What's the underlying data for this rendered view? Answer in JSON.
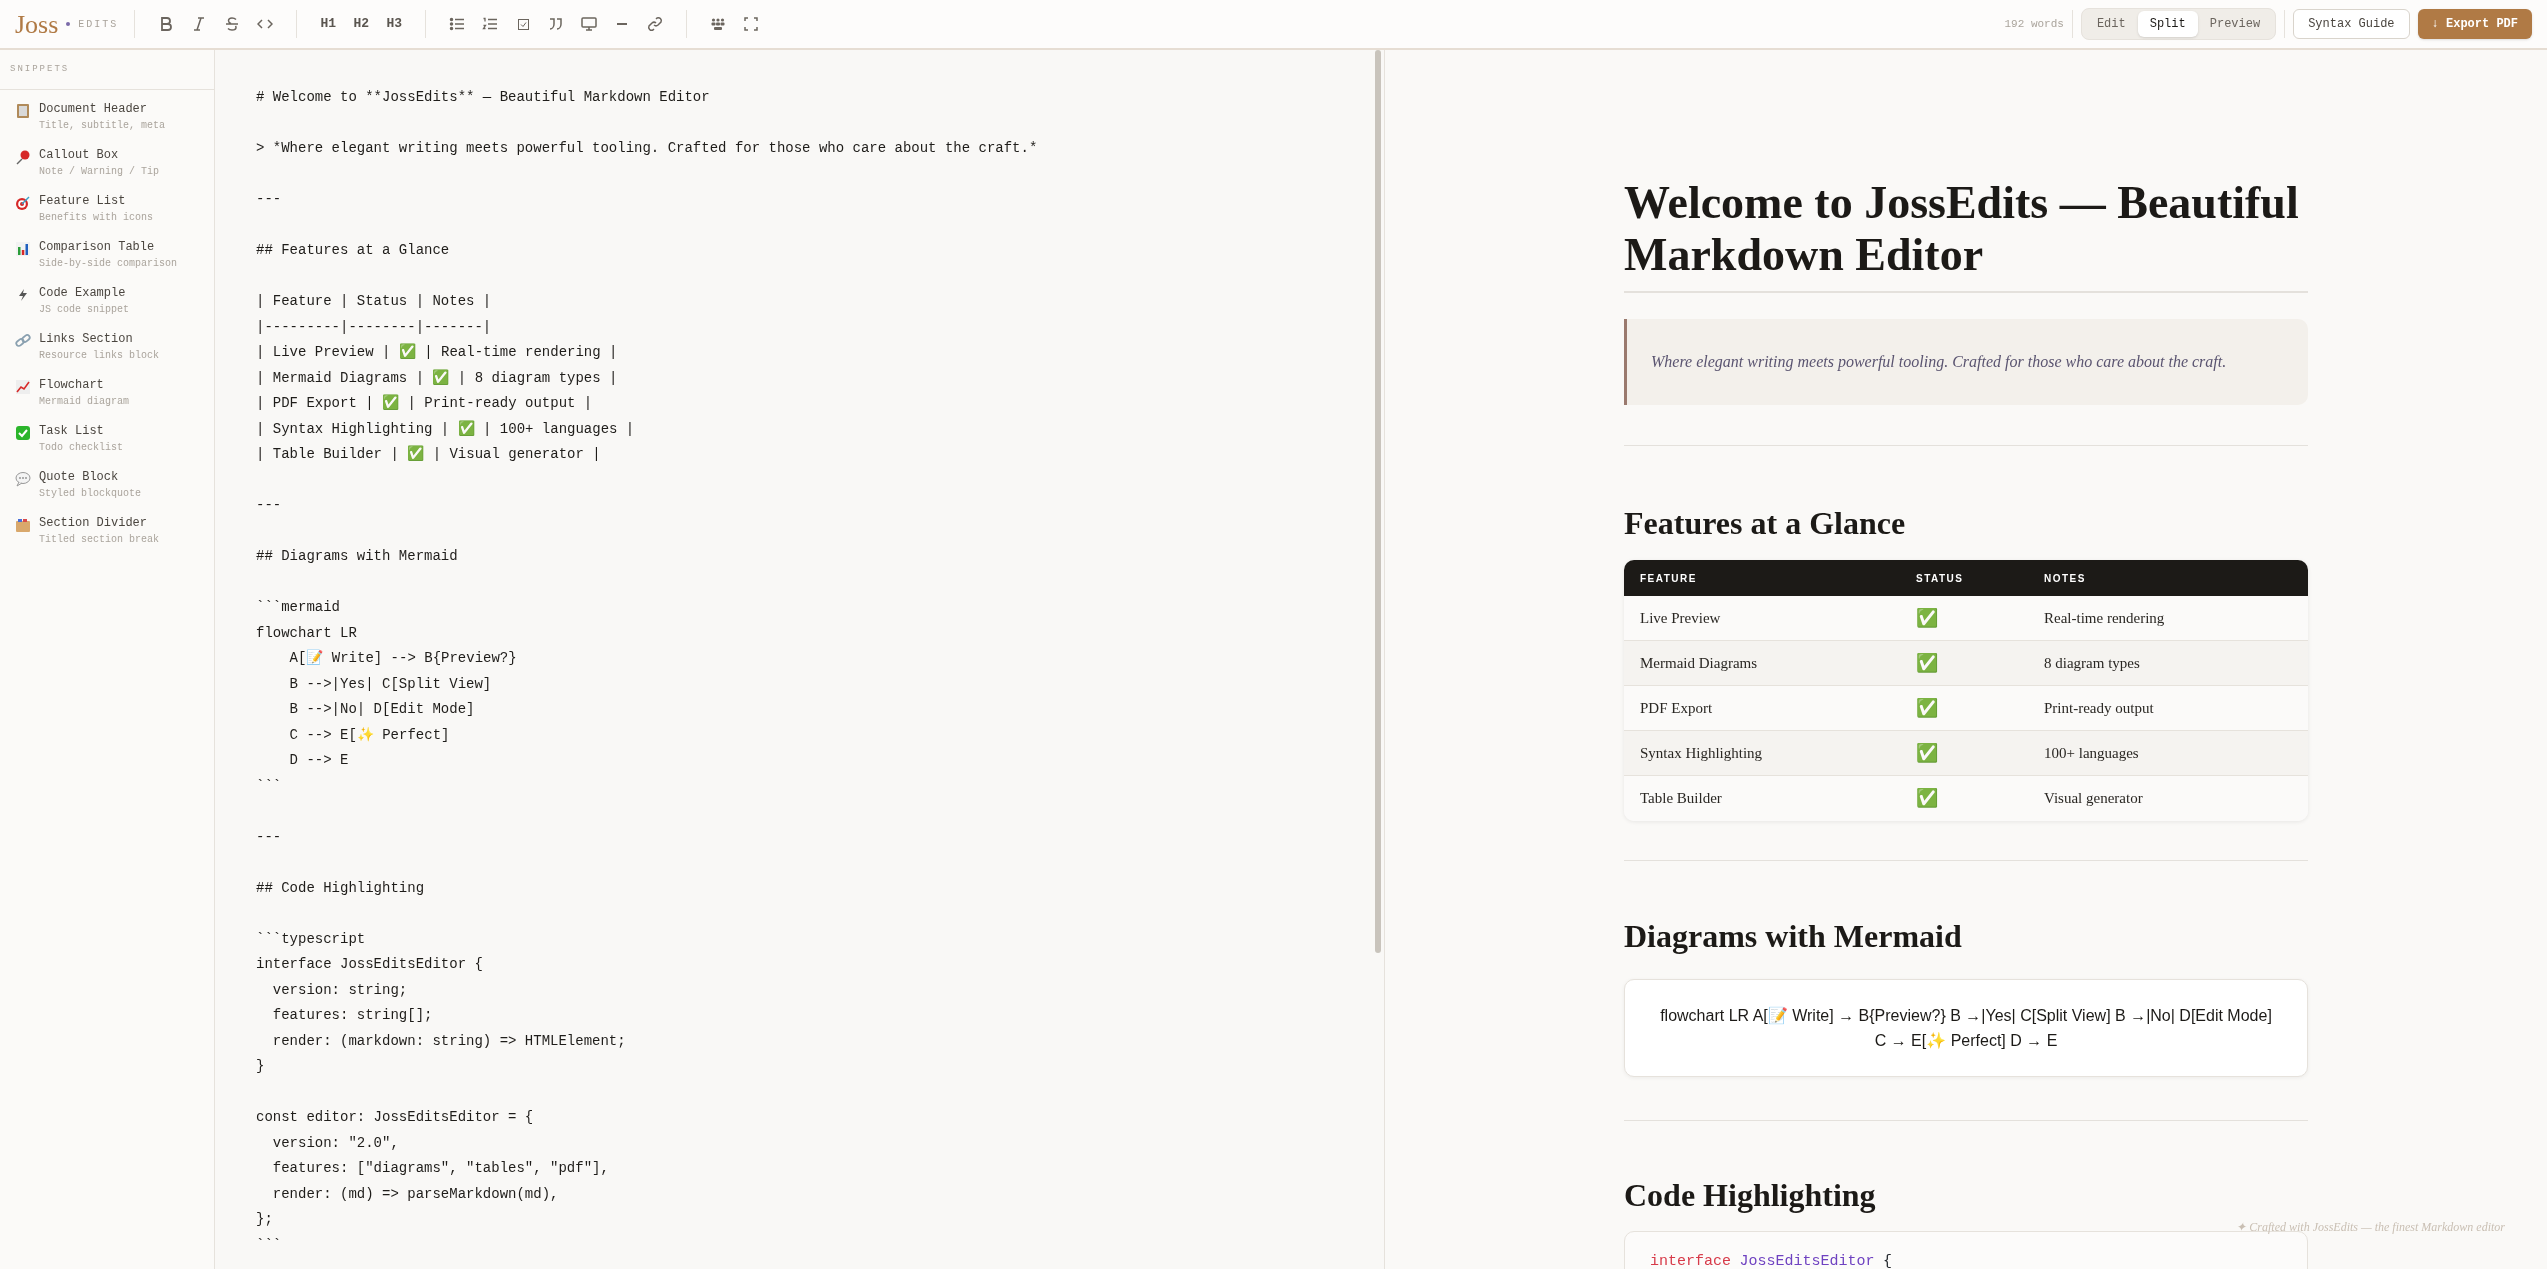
{
  "toolbar": {
    "logo": "Joss",
    "logo_suffix": "EDITS",
    "headings": [
      "H1",
      "H2",
      "H3"
    ],
    "word_count": "192 words",
    "view_modes": [
      {
        "label": "Edit",
        "selected": false
      },
      {
        "label": "Split",
        "selected": true
      },
      {
        "label": "Preview",
        "selected": false
      }
    ],
    "syntax_guide": "Syntax Guide",
    "export": "↓ Export PDF"
  },
  "sidebar": {
    "title": "SNIPPETS",
    "items": [
      {
        "title": "Document Header",
        "subtitle": "Title, subtitle, meta"
      },
      {
        "title": "Callout Box",
        "subtitle": "Note / Warning / Tip"
      },
      {
        "title": "Feature List",
        "subtitle": "Benefits with icons"
      },
      {
        "title": "Comparison Table",
        "subtitle": "Side-by-side comparison"
      },
      {
        "title": "Code Example",
        "subtitle": "JS code snippet"
      },
      {
        "title": "Links Section",
        "subtitle": "Resource links block"
      },
      {
        "title": "Flowchart",
        "subtitle": "Mermaid diagram"
      },
      {
        "title": "Task List",
        "subtitle": "Todo checklist"
      },
      {
        "title": "Quote Block",
        "subtitle": "Styled blockquote"
      },
      {
        "title": "Section Divider",
        "subtitle": "Titled section break"
      }
    ]
  },
  "editor": {
    "blocks": [
      [
        "# Welcome to **JossEdits** — Beautiful Markdown Editor"
      ],
      [
        "> *Where elegant writing meets powerful tooling. Crafted for those who care about the craft.*"
      ],
      [
        "---"
      ],
      [
        "## Features at a Glance"
      ],
      [
        "| Feature | Status | Notes |",
        "|---------|--------|-------|",
        "| Live Preview | ✅ | Real-time rendering |",
        "| Mermaid Diagrams | ✅ | 8 diagram types |",
        "| PDF Export | ✅ | Print-ready output |",
        "| Syntax Highlighting | ✅ | 100+ languages |",
        "| Table Builder | ✅ | Visual generator |"
      ],
      [
        "---"
      ],
      [
        "## Diagrams with Mermaid"
      ],
      [
        "```mermaid",
        "flowchart LR",
        "    A[📝 Write] --> B{Preview?}",
        "    B -->|Yes| C[Split View]",
        "    B -->|No| D[Edit Mode]",
        "    C --> E[✨ Perfect]",
        "    D --> E",
        "```"
      ],
      [
        "---"
      ],
      [
        "## Code Highlighting"
      ],
      [
        "```typescript",
        "interface JossEditsEditor {",
        "  version: string;",
        "  features: string[];",
        "  render: (markdown: string) => HTMLElement;",
        "}"
      ],
      [
        "const editor: JossEditsEditor = {",
        "  version: \"2.0\",",
        "  features: [\"diagrams\", \"tables\", \"pdf\"],",
        "  render: (md) => parseMarkdown(md),",
        "};",
        "```"
      ]
    ]
  },
  "preview": {
    "title": "Welcome to JossEdits — Beautiful Markdown Editor",
    "quote": "Where elegant writing meets powerful tooling. Crafted for those who care about the craft.",
    "features_heading": "Features at a Glance",
    "table": {
      "columns": [
        "FEATURE",
        "STATUS",
        "NOTES"
      ],
      "rows": [
        [
          "Live Preview",
          "✅",
          "Real-time rendering"
        ],
        [
          "Mermaid Diagrams",
          "✅",
          "8 diagram types"
        ],
        [
          "PDF Export",
          "✅",
          "Print-ready output"
        ],
        [
          "Syntax Highlighting",
          "✅",
          "100+ languages"
        ],
        [
          "Table Builder",
          "✅",
          "Visual generator"
        ]
      ]
    },
    "diagrams_heading": "Diagrams with Mermaid",
    "mermaid_text": "flowchart LR A[📝 Write] → B{Preview?} B →|Yes| C[Split View] B →|No| D[Edit Mode] C → E[✨ Perfect] D → E",
    "code_heading": "Code Highlighting",
    "code_line": [
      {
        "text": "interface",
        "kind": "keyword"
      },
      {
        "text": "JossEditsEditor",
        "kind": "type"
      },
      {
        "text": "{",
        "kind": "punct"
      }
    ]
  },
  "footer": "✦ Crafted with JossEdits — the finest Markdown editor"
}
